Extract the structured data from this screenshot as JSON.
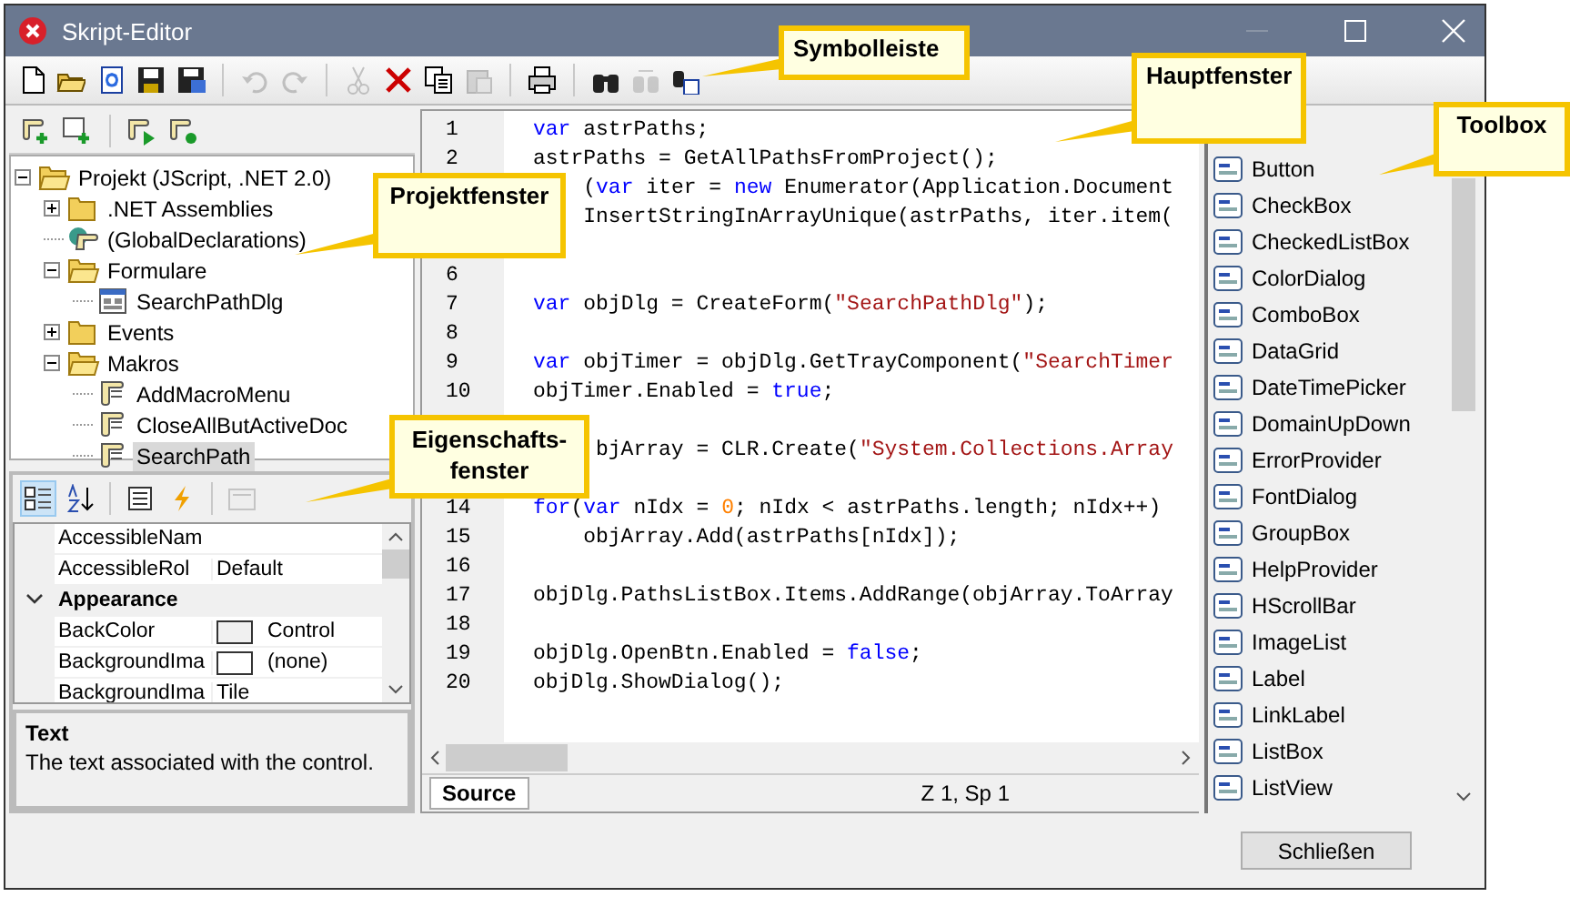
{
  "window": {
    "title": "Skript-Editor"
  },
  "toolbar": {
    "groups": [
      {
        "buttons": [
          {
            "disabled": false
          },
          {
            "disabled": false
          },
          {
            "disabled": false
          },
          {
            "disabled": false
          },
          {
            "disabled": false
          }
        ]
      },
      {
        "buttons": [
          {
            "disabled": true
          },
          {
            "disabled": true
          }
        ]
      },
      {
        "buttons": [
          {
            "disabled": true
          },
          {
            "disabled": false
          },
          {
            "disabled": false
          },
          {
            "disabled": true
          }
        ]
      },
      {
        "buttons": [
          {
            "disabled": false
          }
        ]
      },
      {
        "buttons": [
          {
            "disabled": false
          },
          {
            "disabled": true
          },
          {
            "disabled": false
          }
        ]
      }
    ]
  },
  "project_toolbar": {
    "buttons": [
      {
        "disabled": false
      },
      {
        "disabled": false
      },
      {
        "disabled": false
      },
      {
        "disabled": false
      }
    ]
  },
  "tree": [
    {
      "label": "Projekt (JScript, .NET 2.0)",
      "kind": "folder",
      "expanded": true,
      "selected": false,
      "children": [
        {
          "label": ".NET Assemblies",
          "kind": "folder",
          "expanded": false,
          "selected": false
        },
        {
          "label": "(GlobalDeclarations)",
          "kind": "globals",
          "selected": false
        },
        {
          "label": "Formulare",
          "kind": "folder",
          "expanded": true,
          "selected": false,
          "children": [
            {
              "label": "SearchPathDlg",
              "kind": "form",
              "selected": false
            }
          ]
        },
        {
          "label": "Events",
          "kind": "folder",
          "expanded": false,
          "selected": false
        },
        {
          "label": "Makros",
          "kind": "folder",
          "expanded": true,
          "selected": false,
          "children": [
            {
              "label": "AddMacroMenu",
              "kind": "script",
              "selected": false
            },
            {
              "label": "CloseAllButActiveDoc",
              "kind": "script",
              "selected": false
            },
            {
              "label": "SearchPath",
              "kind": "script",
              "selected": true
            }
          ]
        }
      ]
    }
  ],
  "properties": {
    "toolbar": [
      {
        "selected": true,
        "disabled": false
      },
      {
        "selected": false,
        "disabled": false
      },
      {
        "selected": false,
        "disabled": false
      },
      {
        "selected": false,
        "disabled": false
      },
      {
        "selected": false,
        "disabled": true
      }
    ],
    "rows": [
      {
        "kind": "prop",
        "name": "AccessibleNam"
      },
      {
        "kind": "prop",
        "name": "AccessibleRol",
        "value": "Default"
      },
      {
        "kind": "category",
        "name": "Appearance",
        "expanded": true
      },
      {
        "kind": "color",
        "name": "BackColor",
        "value": "Control",
        "color": "#f0f0f0"
      },
      {
        "kind": "color",
        "name": "BackgroundIma",
        "value": "(none)",
        "color": "#ffffff"
      },
      {
        "kind": "prop",
        "name": "BackgroundIma",
        "value": "Tile"
      }
    ],
    "description": {
      "title": "Text",
      "text": "The text associated with the control."
    }
  },
  "editor": {
    "lines": [
      {
        "number": "1",
        "segments": [
          {
            "kind": "kw",
            "text": "var"
          },
          {
            "kind": "plain",
            "text": " astrPaths;"
          }
        ]
      },
      {
        "number": "2",
        "segments": [
          {
            "kind": "plain",
            "text": "astrPaths = GetAllPathsFromProject();"
          }
        ]
      },
      {
        "kind": "code",
        "segments": [
          {
            "kind": "plain",
            "text": "    ("
          },
          {
            "kind": "kw",
            "text": "var"
          },
          {
            "kind": "plain",
            "text": " iter = "
          },
          {
            "kind": "kw",
            "text": "new"
          },
          {
            "kind": "plain",
            "text": " Enumerator(Application.Document"
          }
        ]
      },
      {
        "kind": "code",
        "segments": [
          {
            "kind": "plain",
            "text": "    InsertStringInArrayUnique(astrPaths, iter.item("
          }
        ]
      },
      {
        "kind": "covered"
      },
      {
        "number": "6"
      },
      {
        "number": "7",
        "segments": [
          {
            "kind": "kw",
            "text": "var"
          },
          {
            "kind": "plain",
            "text": " objDlg = CreateForm("
          },
          {
            "kind": "str",
            "text": "\"SearchPathDlg\""
          },
          {
            "kind": "plain",
            "text": ");"
          }
        ]
      },
      {
        "number": "8"
      },
      {
        "number": "9",
        "segments": [
          {
            "kind": "kw",
            "text": "var"
          },
          {
            "kind": "plain",
            "text": " objTimer = objDlg.GetTrayComponent("
          },
          {
            "kind": "str",
            "text": "\"SearchTimer"
          }
        ]
      },
      {
        "number": "10",
        "segments": [
          {
            "kind": "plain",
            "text": "objTimer.Enabled = "
          },
          {
            "kind": "kw",
            "text": "true"
          },
          {
            "kind": "plain",
            "text": ";"
          }
        ]
      },
      {
        "kind": "covered"
      },
      {
        "kind": "code",
        "segments": [
          {
            "kind": "plain",
            "text": "     bjArray = CLR.Create("
          },
          {
            "kind": "str",
            "text": "\"System.Collections.Array"
          }
        ]
      },
      {
        "kind": "covered"
      },
      {
        "number": "14",
        "segments": [
          {
            "kind": "kw",
            "text": "for"
          },
          {
            "kind": "plain",
            "text": "("
          },
          {
            "kind": "kw",
            "text": "var"
          },
          {
            "kind": "plain",
            "text": " nIdx = "
          },
          {
            "kind": "num",
            "text": "0"
          },
          {
            "kind": "plain",
            "text": "; nIdx < astrPaths.length; nIdx++)"
          }
        ]
      },
      {
        "number": "15",
        "segments": [
          {
            "kind": "plain",
            "text": "    objArray.Add(astrPaths[nIdx]);"
          }
        ]
      },
      {
        "number": "16"
      },
      {
        "number": "17",
        "segments": [
          {
            "kind": "plain",
            "text": "objDlg.PathsListBox.Items.AddRange(objArray.ToArray"
          }
        ]
      },
      {
        "number": "18"
      },
      {
        "number": "19",
        "segments": [
          {
            "kind": "plain",
            "text": "objDlg.OpenBtn.Enabled = "
          },
          {
            "kind": "kw",
            "text": "false"
          },
          {
            "kind": "plain",
            "text": ";"
          }
        ]
      },
      {
        "number": "20",
        "segments": [
          {
            "kind": "plain",
            "text": "objDlg.ShowDialog();"
          }
        ]
      }
    ],
    "tabs": [
      {
        "label": "Source",
        "selected": true
      }
    ],
    "position": "Z 1, Sp 1"
  },
  "toolbox": {
    "items": [
      {
        "label": "Button"
      },
      {
        "label": "CheckBox"
      },
      {
        "label": "CheckedListBox"
      },
      {
        "label": "ColorDialog"
      },
      {
        "label": "ComboBox"
      },
      {
        "label": "DataGrid"
      },
      {
        "label": "DateTimePicker"
      },
      {
        "label": "DomainUpDown"
      },
      {
        "label": "ErrorProvider"
      },
      {
        "label": "FontDialog"
      },
      {
        "label": "GroupBox"
      },
      {
        "label": "HelpProvider"
      },
      {
        "label": "HScrollBar"
      },
      {
        "label": "ImageList"
      },
      {
        "label": "Label"
      },
      {
        "label": "LinkLabel"
      },
      {
        "label": "ListBox"
      },
      {
        "label": "ListView"
      }
    ]
  },
  "close_button": "Schließen",
  "callouts": [
    {
      "kind": "toolbar",
      "lines": [
        "Symbolleiste"
      ]
    },
    {
      "kind": "main",
      "lines": [
        "Hauptfenster"
      ]
    },
    {
      "kind": "toolbox",
      "lines": [
        "Toolbox"
      ]
    },
    {
      "kind": "project",
      "lines": [
        "Projektfenster"
      ]
    },
    {
      "kind": "properties",
      "lines": [
        "Eigenschafts-",
        "fenster"
      ]
    }
  ]
}
